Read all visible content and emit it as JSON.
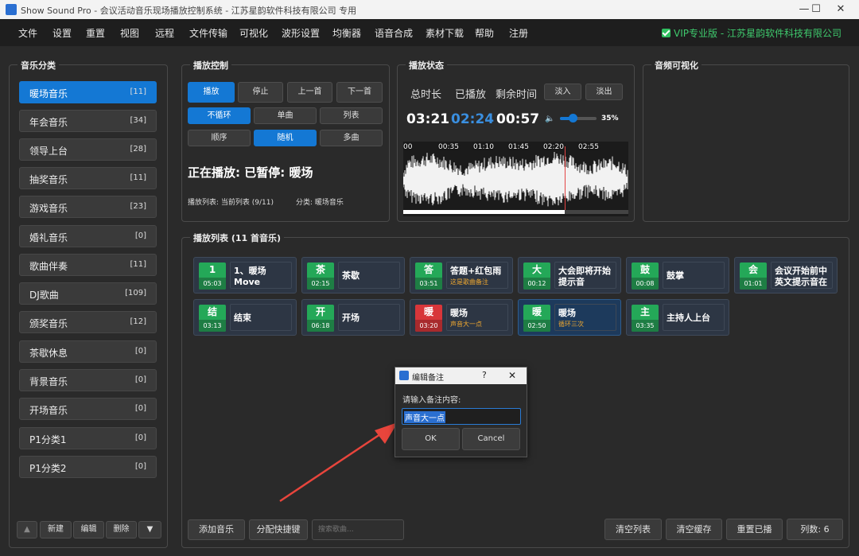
{
  "titlebar": {
    "title": "Show Sound Pro - 会议活动音乐现场播放控制系统 - 江苏星韵软件科技有限公司 专用",
    "minimize": "—",
    "maximize": "☐",
    "close": "✕"
  },
  "menu": [
    "文件",
    "设置",
    "重置",
    "视图",
    "远程",
    "文件传输",
    "可视化",
    "波形设置",
    "均衡器",
    "语音合成",
    "素材下载",
    "帮助",
    "注册"
  ],
  "vip": "VIP专业版 - 江苏星韵软件科技有限公司",
  "category_group_title": "音乐分类",
  "categories": [
    {
      "name": "暖场音乐",
      "count": "[11]"
    },
    {
      "name": "年会音乐",
      "count": "[34]"
    },
    {
      "name": "领导上台",
      "count": "[28]"
    },
    {
      "name": "抽奖音乐",
      "count": "[11]"
    },
    {
      "name": "游戏音乐",
      "count": "[23]"
    },
    {
      "name": "婚礼音乐",
      "count": "[0]"
    },
    {
      "name": "歌曲伴奏",
      "count": "[11]"
    },
    {
      "name": "DJ歌曲",
      "count": "[109]"
    },
    {
      "name": "颁奖音乐",
      "count": "[12]"
    },
    {
      "name": "茶歇休息",
      "count": "[0]"
    },
    {
      "name": "背景音乐",
      "count": "[0]"
    },
    {
      "name": "开场音乐",
      "count": "[0]"
    },
    {
      "name": "P1分类1",
      "count": "[0]"
    },
    {
      "name": "P1分类2",
      "count": "[0]"
    }
  ],
  "category_actions": {
    "up": "▲",
    "new": "新建",
    "edit": "编辑",
    "delete": "删除",
    "down": "▼"
  },
  "playback": {
    "title": "播放控制",
    "buttons": [
      "播放",
      "停止",
      "上一首",
      "下一首"
    ],
    "loop_modes": [
      "不循环",
      "单曲",
      "列表"
    ],
    "order_modes": [
      "顺序",
      "随机",
      "多曲"
    ],
    "now_playing": "正在播放: 已暂停: 暖场",
    "playlist_info": "播放列表: 当前列表 (9/11)",
    "category_info": "分类: 暖场音乐"
  },
  "status": {
    "title": "播放状态",
    "total_label": "总时长",
    "played_label": "已播放",
    "remain_label": "剩余时间",
    "fade_in": "淡入",
    "fade_out": "淡出",
    "total": "03:21",
    "played": "02:24",
    "remain": "00:57",
    "volume": "35%",
    "volume_level": 0.35,
    "timeline": [
      "00",
      "00:35",
      "01:10",
      "01:45",
      "02:20",
      "02:55"
    ],
    "progress": 0.716
  },
  "visual": {
    "title": "音频可视化"
  },
  "playlist": {
    "title": "播放列表 (11 首音乐)",
    "tiles": [
      {
        "badge": "1",
        "time": "05:03",
        "title": "1、暖场",
        "title2": "Move",
        "note": "",
        "color": "green"
      },
      {
        "badge": "茶",
        "time": "02:15",
        "title": "茶歇",
        "title2": "",
        "note": "",
        "color": "green"
      },
      {
        "badge": "答",
        "time": "03:51",
        "title": "答题+红包雨",
        "title2": "",
        "note": "这是歌曲备注",
        "color": "green"
      },
      {
        "badge": "大",
        "time": "00:12",
        "title": "大会即将开始",
        "title2": "提示音",
        "note": "",
        "color": "green"
      },
      {
        "badge": "鼓",
        "time": "00:08",
        "title": "鼓掌",
        "title2": "",
        "note": "",
        "color": "green"
      },
      {
        "badge": "会",
        "time": "01:01",
        "title": "会议开始前中",
        "title2": "英文提示音在",
        "note": "",
        "color": "green"
      },
      {
        "badge": "结",
        "time": "03:13",
        "title": "结束",
        "title2": "",
        "note": "",
        "color": "green"
      },
      {
        "badge": "开",
        "time": "06:18",
        "title": "开场",
        "title2": "",
        "note": "",
        "color": "green"
      },
      {
        "badge": "暖",
        "time": "03:20",
        "title": "暖场",
        "title2": "",
        "note": "声音大一点",
        "color": "red"
      },
      {
        "badge": "暖",
        "time": "02:50",
        "title": "暖场",
        "title2": "",
        "note": "循环三次",
        "color": "green"
      },
      {
        "badge": "主",
        "time": "03:35",
        "title": "主持人上台",
        "title2": "",
        "note": "",
        "color": "green"
      }
    ]
  },
  "bottom": {
    "add": "添加音乐",
    "hotkey": "分配快捷键",
    "search_placeholder": "搜索歌曲...",
    "clear_list": "清空列表",
    "clear_cache": "清空缓存",
    "reset_played": "重置已播",
    "columns": "列数: 6"
  },
  "dialog": {
    "title": "编辑备注",
    "help": "?",
    "close": "✕",
    "prompt": "请输入备注内容:",
    "value": "声音大一点",
    "ok": "OK",
    "cancel": "Cancel"
  },
  "colors": {
    "accent": "#1478d4",
    "played": "#3a8fe0",
    "vip": "#3fc96d",
    "badge_green": "#24a858",
    "badge_red": "#d8363a",
    "arrow": "#e8453c"
  }
}
